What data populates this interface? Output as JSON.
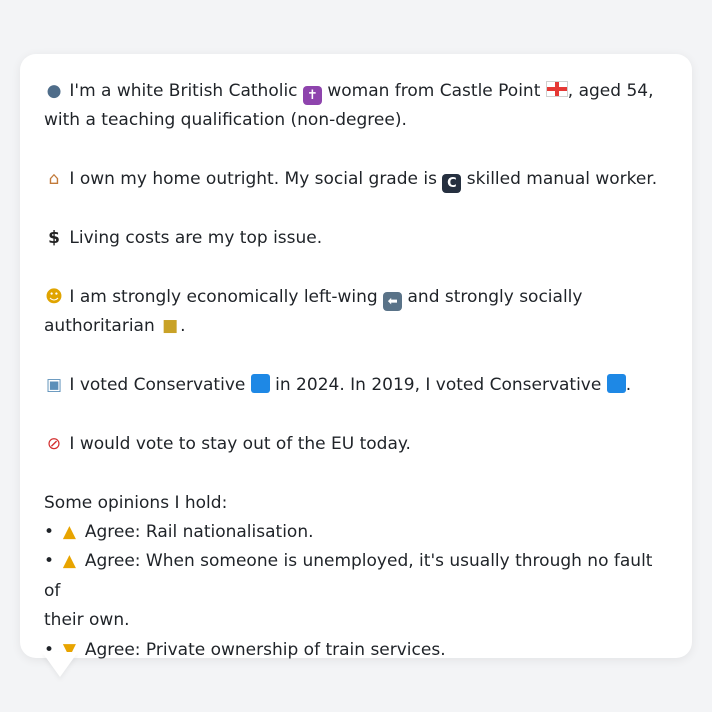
{
  "profile": {
    "line1_a": "I'm a white British Catholic",
    "line1_b": "woman from Castle Point",
    "line1_c": ", aged 54, with",
    "line1_d": "a teaching qualification (non-degree).",
    "home_a": "I own my home outright. My social grade is",
    "home_grade": "C",
    "home_b": "skilled manual worker.",
    "issue": "Living costs are my top issue.",
    "ideology_a": "I am strongly economically left-wing",
    "ideology_b": "and strongly socially authoritarian",
    "vote_a": "I voted Conservative",
    "vote_b": "in 2024. In 2019, I voted Conservative",
    "eu": "I would vote to stay out of the EU today.",
    "opinions_header": "Some opinions I hold:",
    "opinions": [
      {
        "icon": "thumbs-up",
        "text": "Agree: Rail nationalisation."
      },
      {
        "icon": "thumbs-up",
        "text_a": "Agree: When someone is unemployed, it's usually through no fault of",
        "text_b": "their own."
      },
      {
        "icon": "thumbs-down",
        "text": "Agree: Private ownership of train services."
      }
    ]
  },
  "colors": {
    "background": "#f3f4f6",
    "bubble": "#ffffff",
    "text": "#1f2328",
    "conservative_blue": "#1e88e5"
  }
}
